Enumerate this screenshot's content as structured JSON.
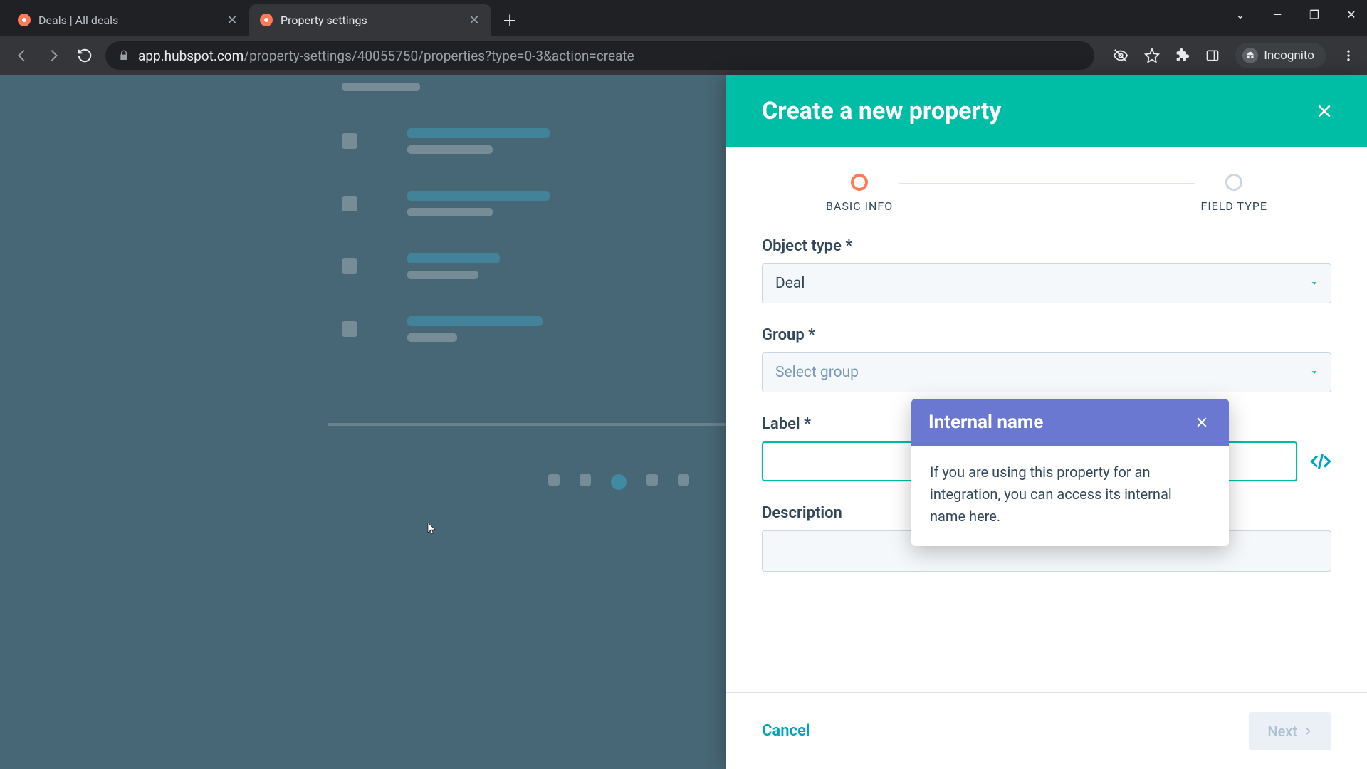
{
  "browser": {
    "tabs": [
      {
        "title": "Deals | All deals",
        "active": false
      },
      {
        "title": "Property settings",
        "active": true
      }
    ],
    "url_host": "app.hubspot.com",
    "url_path": "/property-settings/40055750/properties?type=0-3&action=create",
    "incognito_label": "Incognito"
  },
  "panel": {
    "title": "Create a new property",
    "steps": [
      {
        "label": "BASIC INFO",
        "active": true
      },
      {
        "label": "FIELD TYPE",
        "active": false
      }
    ],
    "fields": {
      "object_type_label": "Object type *",
      "object_type_value": "Deal",
      "group_label": "Group *",
      "group_placeholder": "Select group",
      "label_label": "Label *",
      "label_value": "",
      "description_label": "Description",
      "description_value": ""
    },
    "footer": {
      "cancel": "Cancel",
      "next": "Next"
    }
  },
  "popover": {
    "title": "Internal name",
    "body": "If you are using this property for an integration, you can access its internal name here."
  }
}
